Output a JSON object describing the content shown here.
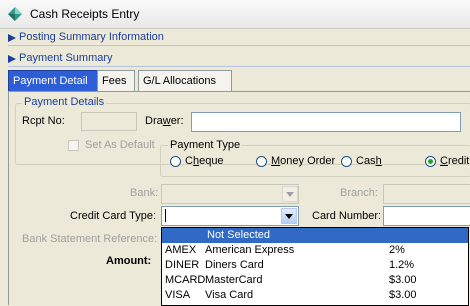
{
  "window": {
    "title": "Cash Receipts Entry",
    "icon": "diamond-app-icon"
  },
  "sections": {
    "posting_summary": "Posting Summary Information",
    "payment_summary": "Payment Summary"
  },
  "tabs": [
    {
      "label": "Payment Detail",
      "active": true
    },
    {
      "label": "Fees",
      "active": false
    },
    {
      "label": "G/L Allocations",
      "active": false
    }
  ],
  "payment_details": {
    "group_title": "Payment Details",
    "rcpt_no_label": "Rcpt No:",
    "rcpt_no_value": "",
    "drawer_label_pre": "Dra",
    "drawer_label_ul": "w",
    "drawer_label_post": "er:",
    "drawer_value": ""
  },
  "set_as_default": {
    "label": "Set As Default",
    "checked": false
  },
  "payment_type": {
    "title": "Payment Type",
    "options": [
      {
        "pre": "C",
        "ul": "h",
        "post": "eque",
        "checked": false
      },
      {
        "pre": "",
        "ul": "M",
        "post": "oney Order",
        "checked": false
      },
      {
        "pre": "Cas",
        "ul": "h",
        "post": "",
        "checked": false
      },
      {
        "pre": "",
        "ul": "C",
        "post": "redit",
        "checked": true
      }
    ]
  },
  "bank": {
    "label": "Bank:",
    "value": ""
  },
  "branch": {
    "label": "Branch:",
    "value": ""
  },
  "credit_card_type": {
    "label": "Credit Card Type:",
    "value": ""
  },
  "card_number": {
    "label": "Card Number:",
    "value": ""
  },
  "bank_statement_reference": {
    "label": "Bank Statement Reference:"
  },
  "amount": {
    "label": "Amount:"
  },
  "dropdown": {
    "selected_label": "Not Selected",
    "items": [
      {
        "code": "AMEX",
        "name": "American Express",
        "fee": "2%"
      },
      {
        "code": "DINER",
        "name": "Diners Card",
        "fee": "1.2%"
      },
      {
        "code": "MCARD",
        "name": "MasterCard",
        "fee": "$3.00"
      },
      {
        "code": "VISA",
        "name": "Visa Card",
        "fee": "$3.00"
      }
    ]
  },
  "colors": {
    "accent": "#2d5ed6",
    "section_text": "#1b3e9c",
    "selection": "#316ac5"
  }
}
